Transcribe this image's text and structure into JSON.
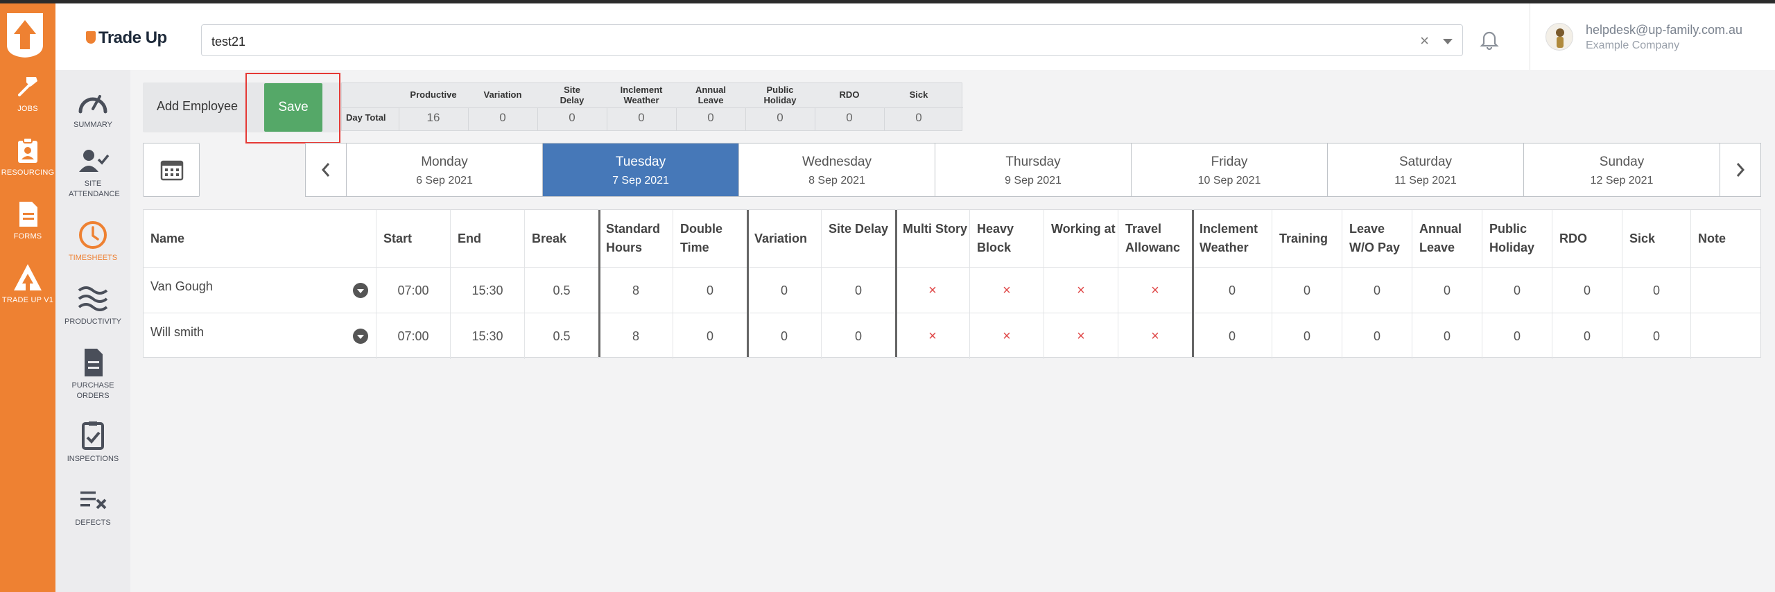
{
  "app": {
    "brand": "Trade Up"
  },
  "rail": [
    {
      "label": "JOBS",
      "icon": "hammer-icon"
    },
    {
      "label": "RESOURCING",
      "icon": "clipboard-person-icon"
    },
    {
      "label": "FORMS",
      "icon": "document-icon"
    },
    {
      "label": "TRADE UP V1",
      "icon": "tradeup-logo-icon"
    }
  ],
  "sidebar": [
    {
      "label": "SUMMARY",
      "icon": "gauge-icon"
    },
    {
      "label": "SITE ATTENDANCE",
      "icon": "user-check-icon"
    },
    {
      "label": "TIMESHEETS",
      "icon": "clock-icon",
      "active": true
    },
    {
      "label": "PRODUCTIVITY",
      "icon": "waves-icon"
    },
    {
      "label": "PURCHASE ORDERS",
      "icon": "file-icon"
    },
    {
      "label": "INSPECTIONS",
      "icon": "checklist-icon"
    },
    {
      "label": "DEFECTS",
      "icon": "list-x-icon"
    }
  ],
  "header": {
    "search_value": "test21",
    "clear_glyph": "×",
    "user_email": "helpdesk@up-family.com.au",
    "user_company": "Example Company"
  },
  "toolbar": {
    "add_employee": "Add Employee",
    "save": "Save"
  },
  "day_total": {
    "label": "Day Total",
    "columns": [
      {
        "name": "Productive",
        "value": "16"
      },
      {
        "name": "Variation",
        "value": "0"
      },
      {
        "name": "Site Delay",
        "value": "0"
      },
      {
        "name": "Inclement Weather",
        "value": "0"
      },
      {
        "name": "Annual Leave",
        "value": "0"
      },
      {
        "name": "Public Holiday",
        "value": "0"
      },
      {
        "name": "RDO",
        "value": "0"
      },
      {
        "name": "Sick",
        "value": "0"
      }
    ]
  },
  "days": [
    {
      "name": "Monday",
      "date": "6 Sep 2021"
    },
    {
      "name": "Tuesday",
      "date": "7 Sep 2021",
      "active": true
    },
    {
      "name": "Wednesday",
      "date": "8 Sep 2021"
    },
    {
      "name": "Thursday",
      "date": "9 Sep 2021"
    },
    {
      "name": "Friday",
      "date": "10 Sep 2021"
    },
    {
      "name": "Saturday",
      "date": "11 Sep 2021"
    },
    {
      "name": "Sunday",
      "date": "12 Sep 2021"
    }
  ],
  "table": {
    "headers": [
      "Name",
      "Start",
      "End",
      "Break",
      "Standard Hours",
      "Double Time",
      "Variation",
      "Site Delay",
      "Multi Story",
      "Heavy Block",
      "Working at",
      "Travel Allowanc",
      "Inclement Weather",
      "Training",
      "Leave W/O Pay",
      "Annual Leave",
      "Public Holiday",
      "RDO",
      "Sick",
      "Note"
    ],
    "rows": [
      {
        "name": "Van Gough",
        "cells": [
          "07:00",
          "15:30",
          "0.5",
          "8",
          "0",
          "0",
          "0",
          "×",
          "×",
          "×",
          "×",
          "0",
          "0",
          "0",
          "0",
          "0",
          "0",
          "0",
          ""
        ]
      },
      {
        "name": "Will smith",
        "cells": [
          "07:00",
          "15:30",
          "0.5",
          "8",
          "0",
          "0",
          "0",
          "×",
          "×",
          "×",
          "×",
          "0",
          "0",
          "0",
          "0",
          "0",
          "0",
          "0",
          ""
        ]
      }
    ]
  },
  "colors": {
    "accent": "#ee8132",
    "save": "#55a868",
    "active_day": "#4678b8",
    "cross": "#e04a4a"
  }
}
